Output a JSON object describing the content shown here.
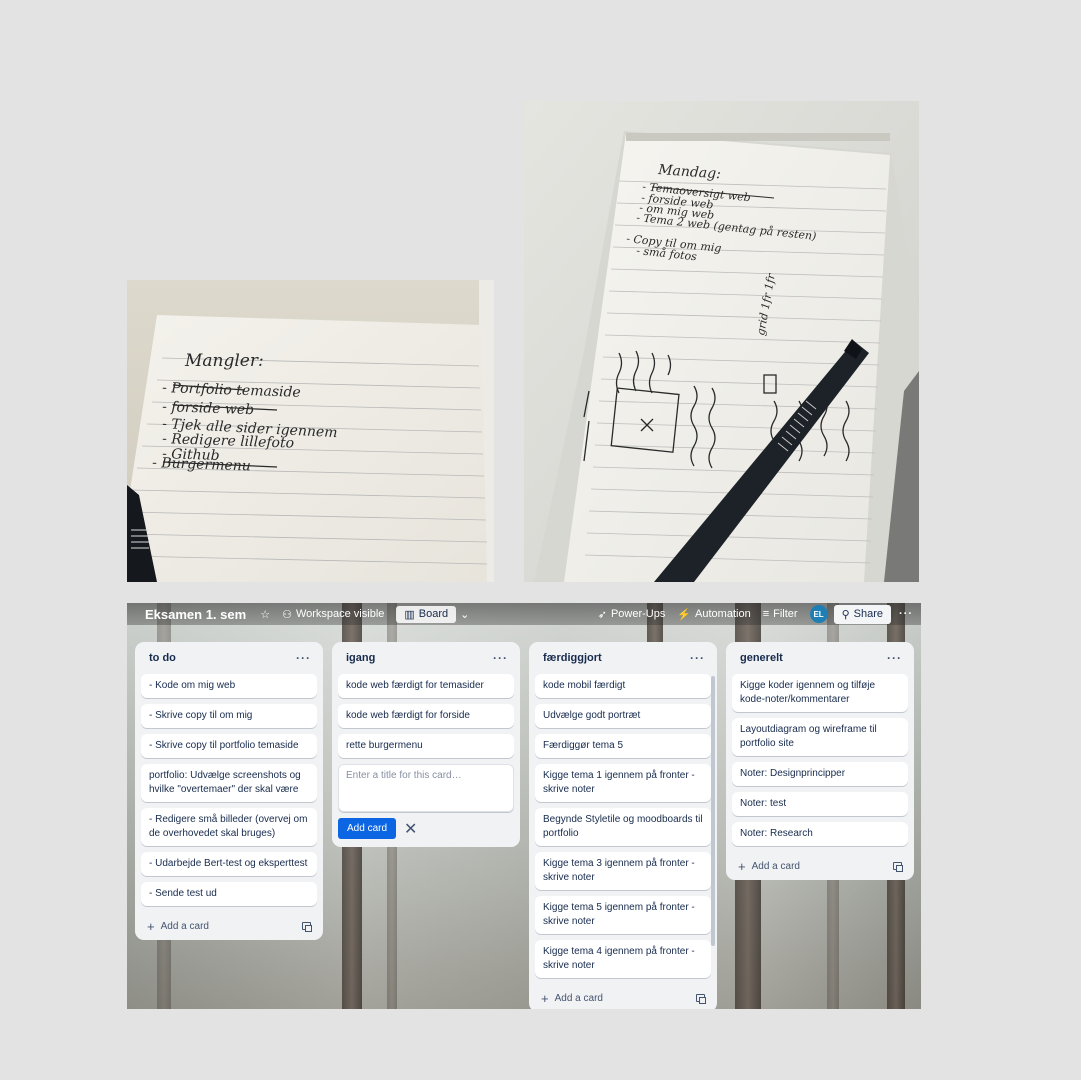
{
  "photos": {
    "left": {
      "heading": "Mangler:",
      "lines": [
        "- Portfolio temaside",
        "- forside web",
        "- Tjek alle sider igennem",
        "- Redigere lillefoto",
        "- Github",
        "- Burgermenu"
      ]
    },
    "right": {
      "heading": "Mandag:",
      "lines": [
        "- Temaoversigt web",
        "- forside web",
        "- om mig web",
        "- Tema 2 web (gentag på resten)",
        "- Copy til om mig",
        "- små fotos"
      ],
      "sketch_label": "grid 1fr 1fr"
    }
  },
  "board": {
    "title": "Eksamen 1. sem",
    "visibility": "Workspace visible",
    "view": "Board",
    "powerups": "Power-Ups",
    "automation": "Automation",
    "filter": "Filter",
    "avatar": "EL",
    "share": "Share",
    "more": "···",
    "add_card_label": "Add a card",
    "lists": [
      {
        "title": "to do",
        "cards": [
          "- Kode om mig web",
          "- Skrive copy til om mig",
          "- Skrive copy til portfolio temaside",
          "portfolio: Udvælge screenshots og hvilke \"overtemaer\" der skal være",
          "- Redigere små billeder (overvej om de overhovedet skal bruges)",
          "- Udarbejde Bert-test og eksperttest",
          "- Sende test ud"
        ]
      },
      {
        "title": "igang",
        "cards": [
          "kode web færdigt for temasider",
          "kode web færdigt for forside",
          "rette burgermenu"
        ],
        "composer": {
          "placeholder": "Enter a title for this card…",
          "add_button": "Add card"
        }
      },
      {
        "title": "færdiggjort",
        "cards": [
          "kode mobil færdigt",
          "Udvælge godt portræt",
          "Færdiggør tema 5",
          "Kigge tema 1 igennem på fronter - skrive noter",
          "Begynde Styletile og moodboards til portfolio",
          "Kigge tema 3 igennem på fronter - skrive noter",
          "Kigge tema 5 igennem på fronter - skrive noter",
          "Kigge tema 4 igennem på fronter - skrive noter"
        ]
      },
      {
        "title": "generelt",
        "cards": [
          "Kigge koder igennem og tilføje kode-noter/kommentarer",
          "Layoutdiagram og wireframe til portfolio site",
          "Noter: Designprincipper",
          "Noter: test",
          "Noter: Research"
        ]
      }
    ]
  }
}
